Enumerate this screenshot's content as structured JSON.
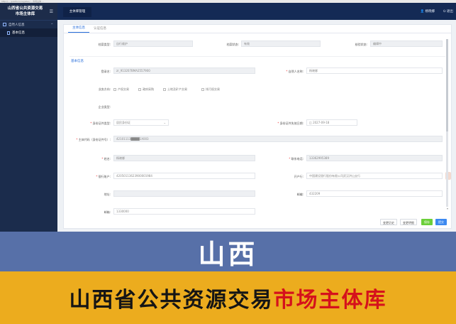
{
  "browser": {
    "address": "http://... /platform/register/... 市场主体 ..."
  },
  "sidebar": {
    "title_line1": "山西省公共资源交易",
    "title_line2": "市场主体库",
    "group_label": "自然人信息",
    "item_label": "基本信息"
  },
  "topbar": {
    "tab_label": "主体库管理",
    "user_name": "杨晓娜",
    "logout_label": "退出"
  },
  "tabs": [
    "主体信息",
    "认证信息"
  ],
  "status_row": {
    "type_label": "档案类型:",
    "type_value": "自行维护",
    "archive_label": "档案状态:",
    "archive_value": "有效",
    "verify_label": "核验状态:",
    "verify_value": "编辑中"
  },
  "section_title": "基本信息",
  "form": {
    "reg_no_label": "登录名:",
    "reg_no_value": "zr_913207BMA2557900",
    "person_name_label": "自然人名称:",
    "person_name_value": "杨晓娜",
    "business_label": "业务方向:",
    "business_options": [
      "产权交易",
      "政府采购",
      "土地及矿产交易",
      "排污权交易"
    ],
    "enterprise_type_label": "企业类型:",
    "id_type_label": "身份证件类型:",
    "id_type_value": "居民身份证",
    "id_expire_label": "身份证件失效日期:",
    "id_expire_value": "2027-09-18",
    "id_code_label": "主体代码（身份证件号）:",
    "id_code_value": "42101113████1X003",
    "name_label": "姓名:",
    "name_value": "杨晓娜",
    "phone_label": "联系电话:",
    "phone_value": "13362995389",
    "bank_account_label": "银行账户:",
    "bank_account_value": "42050113623900001984",
    "bank_label": "开户行:",
    "bank_value": "中国建设银行股份有限公司武汉洪山支行",
    "address_label": "地址:",
    "postcode_label": "邮编:",
    "postcode_value": "432209",
    "last_label": "邮箱:",
    "last_value": "1330000"
  },
  "buttons": {
    "history": "变更历史",
    "detail": "变更明细",
    "save": "保存",
    "submit": "提交"
  },
  "banner": {
    "big": "山西",
    "bottom_dark": "山西省公共资源交易",
    "bottom_red": "市场主体库"
  },
  "colors": {
    "sidebar_bg": "#1b2c4c",
    "topbar_bg": "#142a55",
    "banner_blue": "#5770a8",
    "banner_yellow": "#ecac1e",
    "accent_red": "#d5111c",
    "accent_blue": "#2a6fdb"
  }
}
